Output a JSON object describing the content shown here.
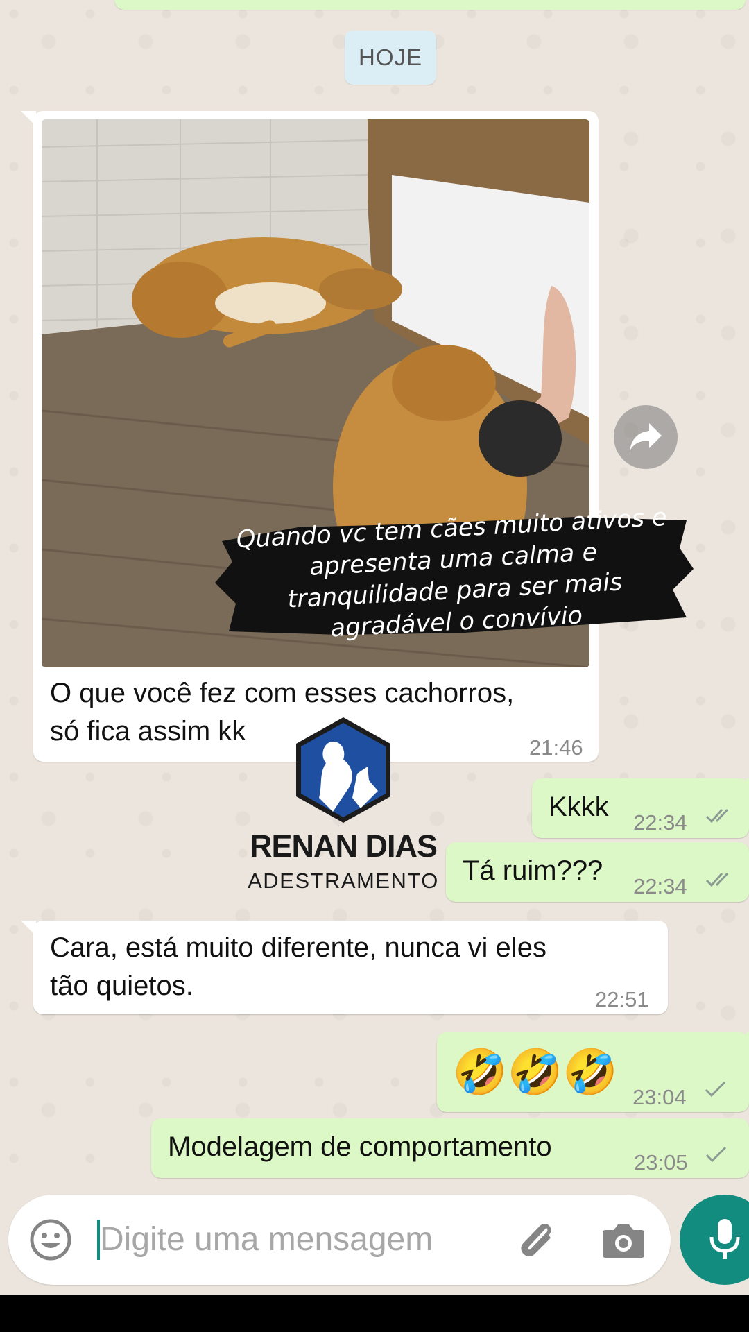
{
  "date_separator": "HOJE",
  "photo_caption": {
    "line1": "Quando vc tem cães muito ativos e",
    "line2": "apresenta uma calma e",
    "line3": "tranquilidade para ser mais",
    "line4": "agradável o convívio"
  },
  "messages": [
    {
      "dir": "in",
      "text_line1": "O que você fez com esses cachorros,",
      "text_line2": "só fica assim kk",
      "time": "21:46"
    },
    {
      "dir": "out",
      "text": "Kkkk",
      "time": "22:34",
      "status": "read"
    },
    {
      "dir": "out",
      "text": "Tá ruim???",
      "time": "22:34",
      "status": "read"
    },
    {
      "dir": "in",
      "text_line1": "Cara, está muito diferente, nunca vi eles",
      "text_line2": "tão quietos.",
      "time": "22:51"
    },
    {
      "dir": "out",
      "text": "🤣🤣🤣",
      "time": "23:04",
      "status": "sent"
    },
    {
      "dir": "out",
      "text": "Modelagem de comportamento",
      "time": "23:05",
      "status": "sent"
    }
  ],
  "watermark": {
    "title": "RENAN DIAS",
    "subtitle": "ADESTRAMENTO"
  },
  "composer": {
    "placeholder": "Digite uma mensagem"
  },
  "icons": {
    "forward": "forward-icon",
    "emoji": "emoji-icon",
    "attach": "paperclip-icon",
    "camera": "camera-icon",
    "mic": "microphone-icon"
  },
  "colors": {
    "incoming_bubble": "#ffffff",
    "outgoing_bubble": "#dcf8c6",
    "accent": "#128c7e",
    "wallpaper": "#ece5dd"
  }
}
